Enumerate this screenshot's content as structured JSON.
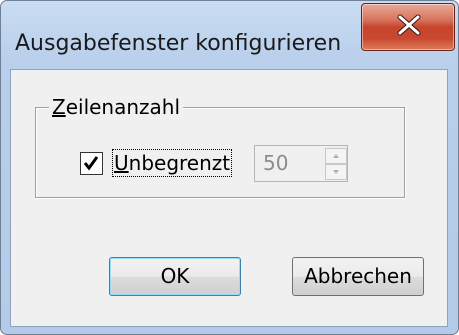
{
  "window": {
    "title": "Ausgabefenster konfigurieren",
    "close_icon": "close-x-icon"
  },
  "group": {
    "legend_accel": "Z",
    "legend_rest": "eilenanzahl"
  },
  "unlimited": {
    "checked": true,
    "label_accel": "U",
    "label_rest": "nbegrenzt"
  },
  "line_count": {
    "value": "50",
    "enabled": false
  },
  "buttons": {
    "ok_label": "OK",
    "cancel_label": "Abbrechen"
  },
  "colors": {
    "frame": "#b9cfeb",
    "close_button": "#c6452c",
    "dialog_face": "#f0f0f0"
  }
}
